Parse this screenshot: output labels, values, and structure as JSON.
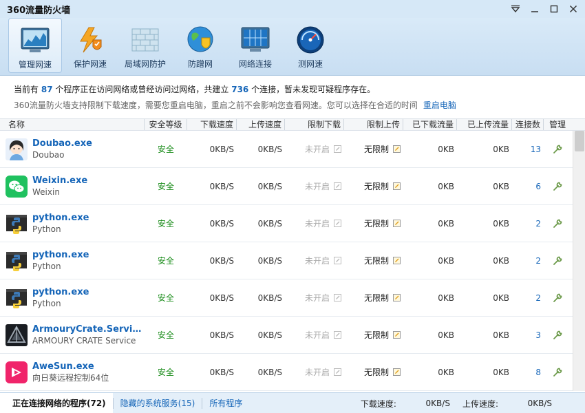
{
  "window": {
    "title": "360流量防火墙"
  },
  "toolbar": {
    "items": [
      {
        "label": "管理网速",
        "icon": "monitor-chart-icon",
        "active": true
      },
      {
        "label": "保护网速",
        "icon": "lightning-shield-icon"
      },
      {
        "label": "局域网防护",
        "icon": "brick-wall-icon"
      },
      {
        "label": "防蹭网",
        "icon": "globe-shield-icon"
      },
      {
        "label": "网络连接",
        "icon": "network-monitor-icon"
      },
      {
        "label": "测网速",
        "icon": "speedometer-icon"
      }
    ]
  },
  "info": {
    "prefix": "当前有",
    "program_count": "87",
    "mid": "个程序正在访问网络或曾经访问过网络，共建立",
    "connection_count": "736",
    "suffix": "个连接，暂未发现可疑程序存在。",
    "line2": "360流量防火墙支持限制下载速度，需要您重启电脑，重启之前不会影响您查看网速。您可以选择在合适的时间",
    "restart_link": "重启电脑"
  },
  "table": {
    "headers": {
      "name": "名称",
      "security": "安全等级",
      "down_speed": "下载速度",
      "up_speed": "上传速度",
      "limit_down": "限制下载",
      "limit_up": "限制上传",
      "downloaded": "已下载流量",
      "uploaded": "已上传流量",
      "connections": "连接数",
      "manage": "管理"
    },
    "rows": [
      {
        "exe": "Doubao.exe",
        "desc": "Doubao",
        "icon": "doubao-avatar-icon",
        "security": "安全",
        "down": "0KB/S",
        "up": "0KB/S",
        "limit_down": "未开启",
        "limit_up": "无限制",
        "downloaded": "0KB",
        "uploaded": "0KB",
        "conn": "13"
      },
      {
        "exe": "Weixin.exe",
        "desc": "Weixin",
        "icon": "wechat-icon",
        "security": "安全",
        "down": "0KB/S",
        "up": "0KB/S",
        "limit_down": "未开启",
        "limit_up": "无限制",
        "downloaded": "0KB",
        "uploaded": "0KB",
        "conn": "6"
      },
      {
        "exe": "python.exe",
        "desc": "Python",
        "icon": "python-icon",
        "security": "安全",
        "down": "0KB/S",
        "up": "0KB/S",
        "limit_down": "未开启",
        "limit_up": "无限制",
        "downloaded": "0KB",
        "uploaded": "0KB",
        "conn": "2"
      },
      {
        "exe": "python.exe",
        "desc": "Python",
        "icon": "python-icon",
        "security": "安全",
        "down": "0KB/S",
        "up": "0KB/S",
        "limit_down": "未开启",
        "limit_up": "无限制",
        "downloaded": "0KB",
        "uploaded": "0KB",
        "conn": "2"
      },
      {
        "exe": "python.exe",
        "desc": "Python",
        "icon": "python-icon",
        "security": "安全",
        "down": "0KB/S",
        "up": "0KB/S",
        "limit_down": "未开启",
        "limit_up": "无限制",
        "downloaded": "0KB",
        "uploaded": "0KB",
        "conn": "2"
      },
      {
        "exe": "ArmouryCrate.Service....",
        "desc": "ARMOURY CRATE Service",
        "icon": "armoury-crate-icon",
        "security": "安全",
        "down": "0KB/S",
        "up": "0KB/S",
        "limit_down": "未开启",
        "limit_up": "无限制",
        "downloaded": "0KB",
        "uploaded": "0KB",
        "conn": "3"
      },
      {
        "exe": "AweSun.exe",
        "desc": "向日葵远程控制64位",
        "icon": "awesun-icon",
        "security": "安全",
        "down": "0KB/S",
        "up": "0KB/S",
        "limit_down": "未开启",
        "limit_up": "无限制",
        "downloaded": "0KB",
        "uploaded": "0KB",
        "conn": "8"
      }
    ]
  },
  "status": {
    "tabs": [
      {
        "label": "正在连接网络的程序(72)",
        "active": true
      },
      {
        "label": "隐藏的系统服务(15)"
      },
      {
        "label": "所有程序"
      }
    ],
    "down_label": "下载速度:",
    "down_value": "0KB/S",
    "up_label": "上传速度:",
    "up_value": "0KB/S"
  },
  "colors": {
    "link": "#1565b8",
    "safe": "#1a8c1a",
    "titlebar": "#d6e8f7"
  }
}
